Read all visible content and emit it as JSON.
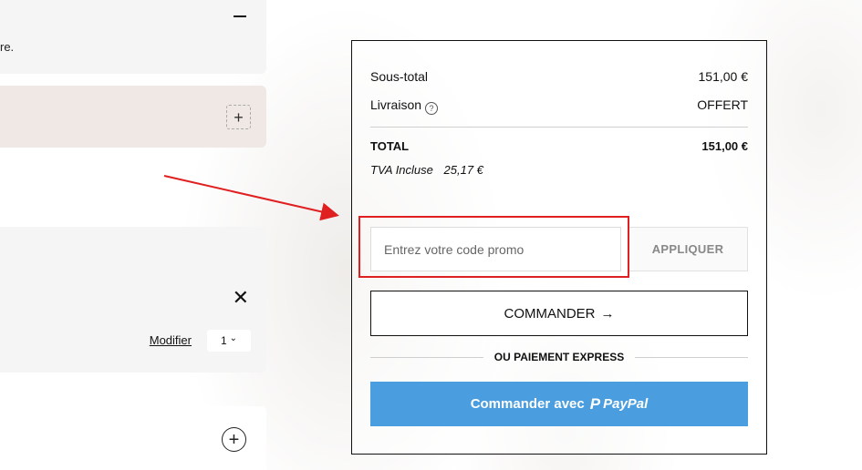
{
  "left": {
    "section1": {
      "fragment_text": "re."
    },
    "item": {
      "modify_label": "Modifier",
      "quantity": "1",
      "quantity_chevron": "⌄"
    }
  },
  "summary": {
    "subtotal_label": "Sous-total",
    "subtotal_value": "151,00 €",
    "shipping_label": "Livraison",
    "shipping_info_glyph": "?",
    "shipping_value": "OFFERT",
    "total_label": "TOTAL",
    "total_value": "151,00 €",
    "tax_label": "TVA Incluse",
    "tax_value": "25,17 €"
  },
  "promo": {
    "placeholder": "Entrez votre code promo",
    "apply_label": "APPLIQUER"
  },
  "checkout": {
    "order_label": "COMMANDER",
    "order_arrow": "→",
    "express_label": "OU PAIEMENT EXPRESS",
    "paypal_prefix": "Commander avec",
    "paypal_mark": "P",
    "paypal_brand": "PayPal"
  },
  "icons": {
    "minus": "minus-icon",
    "plus": "plus-icon",
    "close": "close-icon",
    "info": "info-icon",
    "arrow_right": "arrow-right-icon",
    "paypal": "paypal-icon"
  },
  "colors": {
    "paypal_button": "#4a9ee0",
    "annotation_red": "#e02020",
    "panel_beige": "#efe8e4",
    "panel_gray": "#f5f5f5"
  }
}
